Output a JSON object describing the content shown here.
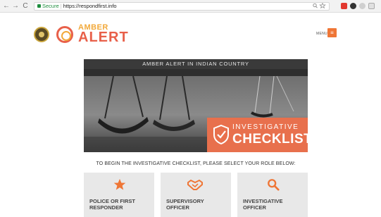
{
  "browser": {
    "back": "←",
    "forward": "→",
    "reload": "C",
    "secure_label": "Secure",
    "url": "https://respondfirst.info"
  },
  "header": {
    "logo_top": "AMBER",
    "logo_bottom": "ALERT",
    "menu_label": "MENU",
    "menu_icon": "≡"
  },
  "hero": {
    "title": "AMBER ALERT IN INDIAN COUNTRY",
    "badge_line1": "INVESTIGATIVE",
    "badge_line2": "CHECKLIST"
  },
  "instruction": "TO BEGIN THE INVESTIGATIVE CHECKLIST, PLEASE SELECT YOUR ROLE BELOW:",
  "roles": [
    {
      "label": "POLICE OR FIRST RESPONDER",
      "icon": "star-icon"
    },
    {
      "label": "SUPERVISORY OFFICER",
      "icon": "handshake-icon"
    },
    {
      "label": "INVESTIGATIVE OFFICER",
      "icon": "magnifier-icon"
    }
  ],
  "colors": {
    "accent": "#ef7636",
    "badge": "#e8704d",
    "card": "#e8e8e8"
  }
}
